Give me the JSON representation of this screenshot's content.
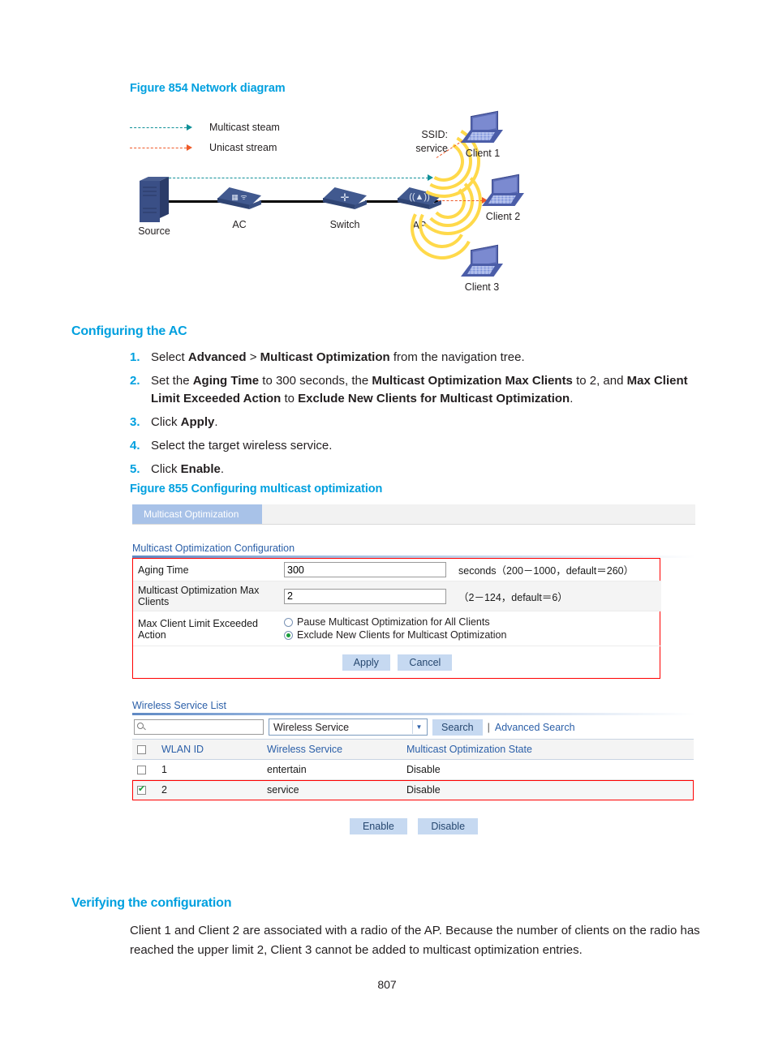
{
  "figure854": {
    "title": "Figure 854 Network diagram",
    "legend": [
      {
        "label": "Multicast steam",
        "color": "#0f9098"
      },
      {
        "label": "Unicast stream",
        "color": "#ef5a28"
      }
    ],
    "ssid_label": "SSID:\nservice",
    "ssid_line1": "SSID:",
    "ssid_line2": "service",
    "devices": [
      {
        "name": "Source",
        "icon": "server-icon"
      },
      {
        "name": "AC",
        "icon": "wireless-controller-icon"
      },
      {
        "name": "Switch",
        "icon": "switch-icon"
      },
      {
        "name": "AP",
        "icon": "access-point-icon"
      },
      {
        "name": "Client 1",
        "icon": "laptop-icon"
      },
      {
        "name": "Client 2",
        "icon": "laptop-icon"
      },
      {
        "name": "Client 3",
        "icon": "laptop-icon"
      }
    ]
  },
  "section_configuring": {
    "heading": "Configuring the AC",
    "steps": [
      {
        "num": "1.",
        "parts": [
          {
            "t": "Select ",
            "b": false
          },
          {
            "t": "Advanced",
            "b": true
          },
          {
            "t": " > ",
            "b": false
          },
          {
            "t": "Multicast Optimization",
            "b": true
          },
          {
            "t": " from the navigation tree.",
            "b": false
          }
        ]
      },
      {
        "num": "2.",
        "parts": [
          {
            "t": "Set the ",
            "b": false
          },
          {
            "t": "Aging Time",
            "b": true
          },
          {
            "t": " to 300 seconds, the ",
            "b": false
          },
          {
            "t": "Multicast Optimization Max Clients",
            "b": true
          },
          {
            "t": " to 2, and ",
            "b": false
          },
          {
            "t": "Max Client Limit Exceeded Action",
            "b": true
          },
          {
            "t": " to ",
            "b": false
          },
          {
            "t": "Exclude New Clients for Multicast Optimization",
            "b": true
          },
          {
            "t": ".",
            "b": false
          }
        ]
      },
      {
        "num": "3.",
        "parts": [
          {
            "t": "Click ",
            "b": false
          },
          {
            "t": "Apply",
            "b": true
          },
          {
            "t": ".",
            "b": false
          }
        ]
      },
      {
        "num": "4.",
        "parts": [
          {
            "t": "Select the target wireless service.",
            "b": false
          }
        ]
      },
      {
        "num": "5.",
        "parts": [
          {
            "t": "Click ",
            "b": false
          },
          {
            "t": "Enable",
            "b": true
          },
          {
            "t": ".",
            "b": false
          }
        ]
      }
    ]
  },
  "figure855": {
    "title": "Figure 855 Configuring multicast optimization",
    "tab_label": "Multicast Optimization",
    "config_section_title": "Multicast Optimization Configuration",
    "fields": {
      "aging_time": {
        "label": "Aging Time",
        "value": "300",
        "hint": "seconds（200－1000，default＝260）"
      },
      "max_clients": {
        "label": "Multicast Optimization Max Clients",
        "value": "2",
        "hint": "（2－124，default＝6）"
      },
      "exceeded_action": {
        "label": "Max Client Limit Exceeded Action",
        "options": [
          {
            "label": "Pause Multicast Optimization for All Clients",
            "selected": false
          },
          {
            "label": "Exclude New Clients for Multicast Optimization",
            "selected": true
          }
        ]
      }
    },
    "form_buttons": {
      "apply": "Apply",
      "cancel": "Cancel"
    },
    "list_section_title": "Wireless Service List",
    "search": {
      "input_value": "",
      "placeholder": "",
      "select_value": "Wireless Service",
      "search_button": "Search",
      "divider": "|",
      "advanced_link": "Advanced Search"
    },
    "table": {
      "columns": [
        "",
        "WLAN ID",
        "Wireless Service",
        "Multicast Optimization State"
      ],
      "rows": [
        {
          "checked": false,
          "wlan_id": "1",
          "service": "entertain",
          "state": "Disable",
          "highlighted": false
        },
        {
          "checked": true,
          "wlan_id": "2",
          "service": "service",
          "state": "Disable",
          "highlighted": true
        }
      ]
    },
    "list_buttons": {
      "enable": "Enable",
      "disable": "Disable"
    }
  },
  "section_verifying": {
    "heading": "Verifying the configuration",
    "paragraph": "Client 1 and Client 2 are associated with a radio of the AP. Because the number of clients on the radio has reached the upper limit 2, Client 3 cannot be added to multicast optimization entries."
  },
  "footer": {
    "page_number": "807"
  },
  "colors": {
    "accent_blue": "#00a0df",
    "link_blue": "#2b5fa8",
    "multicast": "#0f9098",
    "unicast": "#ef5a28",
    "highlight_red": "#ff0000",
    "wifi_wave": "#ffd94a",
    "device_blue": "#41598f"
  }
}
